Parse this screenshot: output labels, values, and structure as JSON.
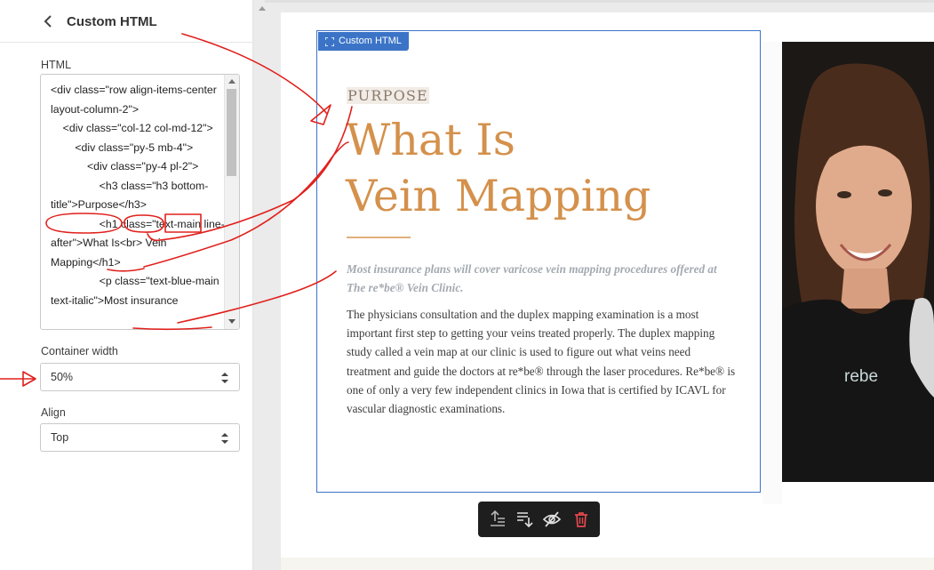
{
  "sidebar": {
    "title": "Custom HTML",
    "html_label": "HTML",
    "html_code": "<div class=\"row align-items-center layout-column-2\">\n    <div class=\"col-12 col-md-12\">\n        <div class=\"py-5 mb-4\">\n            <div class=\"py-4 pl-2\">\n                <h3 class=\"h3 bottom-title\">Purpose</h3>\n                <h1 class=\"text-main line-after\">What Is<br> Vein Mapping</h1>\n                <p class=\"text-blue-main text-italic\">Most insurance",
    "container_width_label": "Container width",
    "container_width_value": "50%",
    "align_label": "Align",
    "align_value": "Top"
  },
  "block": {
    "tag_label": "Custom HTML",
    "purpose": "PURPOSE",
    "heading_line1": "What Is",
    "heading_line2": "Vein Mapping",
    "lead": "Most insurance plans will cover varicose vein mapping procedures offered at The re*be® Vein Clinic.",
    "body": "The physicians consultation and the duplex mapping examination is a most important first step to getting your veins treated properly. The duplex mapping study called a vein map at our clinic is used to figure out what veins need treatment and guide the doctors at re*be® through the laser procedures. Re*be® is one of only a very few independent clinics in Iowa that is certified by ICAVL for vascular diagnostic examinations."
  },
  "photo": {
    "shirt_logo": "rebe"
  },
  "toolbar": {
    "icons": [
      "move-up-icon",
      "move-down-icon",
      "hide-icon",
      "delete-icon"
    ]
  },
  "colors": {
    "accent_blue": "#3b74c7",
    "heading_orange": "#d4914c",
    "annotation_red": "#e0201c",
    "delete_red": "#e5484d"
  }
}
